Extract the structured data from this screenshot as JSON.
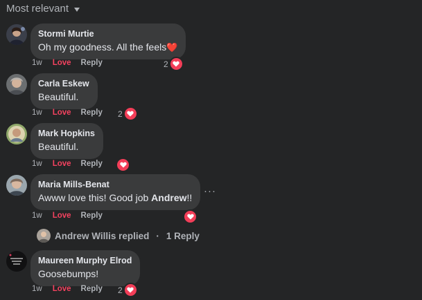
{
  "sort": {
    "label": "Most relevant"
  },
  "comments": [
    {
      "author": "Stormi Murtie",
      "text": "Oh my goodness. All the feels",
      "emoji": "❤️",
      "time": "1w",
      "love": "Love",
      "reply": "Reply",
      "reaction_count": "2"
    },
    {
      "author": "Carla Eskew",
      "text": "Beautiful.",
      "time": "1w",
      "love": "Love",
      "reply": "Reply",
      "reaction_count": "2"
    },
    {
      "author": "Mark Hopkins",
      "text": "Beautiful.",
      "time": "1w",
      "love": "Love",
      "reply": "Reply",
      "reaction_count": ""
    },
    {
      "author": "Maria Mills-Benat",
      "text_before": "Awww love this! Good job ",
      "mention": "Andrew",
      "text_after": "!!",
      "time": "1w",
      "love": "Love",
      "reply": "Reply",
      "reaction_count": "",
      "more": "···"
    },
    {
      "author": "Maureen Murphy Elrod",
      "text": "Goosebumps!",
      "time": "1w",
      "love": "Love",
      "reply": "Reply",
      "reaction_count": "2"
    }
  ],
  "replies": {
    "name": "Andrew Willis replied",
    "separator": "·",
    "count": "1 Reply"
  },
  "colors": {
    "background": "#242526",
    "bubble": "#3a3b3c",
    "love": "#f3425f",
    "heart": "#f33e58"
  },
  "icons": {
    "sort": "chevron-down-icon",
    "reaction": "heart-icon",
    "more": "more-horizontal-icon"
  }
}
